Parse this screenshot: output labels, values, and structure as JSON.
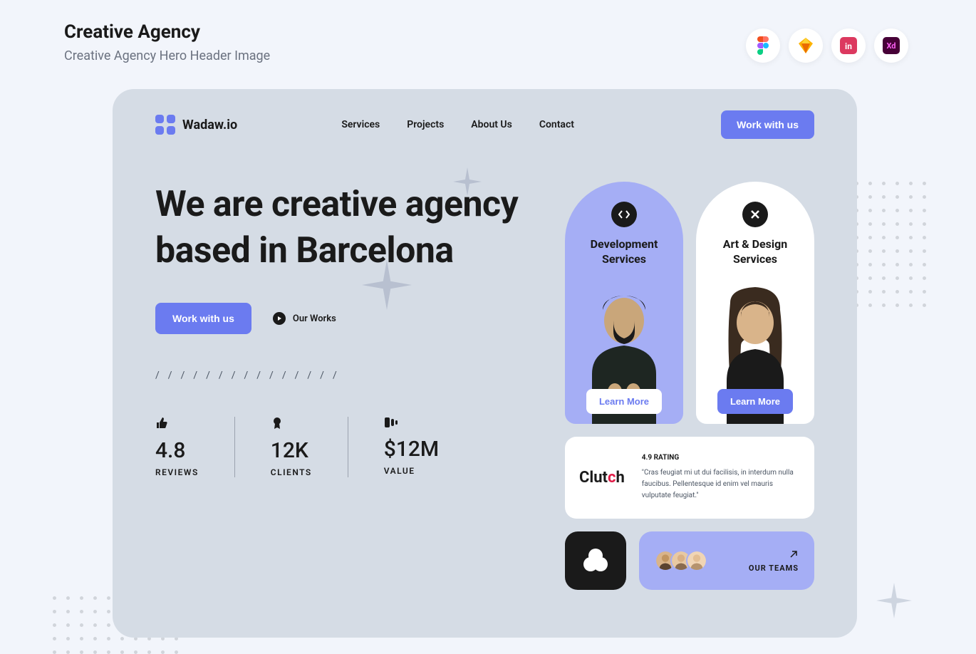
{
  "page": {
    "title": "Creative Agency",
    "subtitle": "Creative Agency Hero Header Image"
  },
  "tools": [
    {
      "name": "figma"
    },
    {
      "name": "sketch"
    },
    {
      "name": "invision"
    },
    {
      "name": "xd"
    }
  ],
  "brand": {
    "name": "Wadaw.io"
  },
  "nav": {
    "items": [
      "Services",
      "Projects",
      "About Us",
      "Contact"
    ],
    "cta": "Work with us"
  },
  "hero": {
    "title": "We are creative agency based in Barcelona",
    "primary_cta": "Work with us",
    "secondary_cta": "Our Works"
  },
  "stats": [
    {
      "icon": "thumbs-up",
      "value": "4.8",
      "label": "REVIEWS"
    },
    {
      "icon": "award",
      "value": "12K",
      "label": "CLIENTS"
    },
    {
      "icon": "money",
      "value": "$12M",
      "label": "VALUE"
    }
  ],
  "services": [
    {
      "title": "Development Services",
      "cta": "Learn More"
    },
    {
      "title": "Art & Design Services",
      "cta": "Learn More"
    }
  ],
  "review": {
    "source": "Clutch",
    "rating_label": "4.9 RATING",
    "quote": "\"Cras feugiat mi ut dui facilisis, in interdum nulla faucibus. Pellentesque id enim vel mauris vulputate feugiat.\""
  },
  "teams": {
    "label": "OUR TEAMS"
  }
}
